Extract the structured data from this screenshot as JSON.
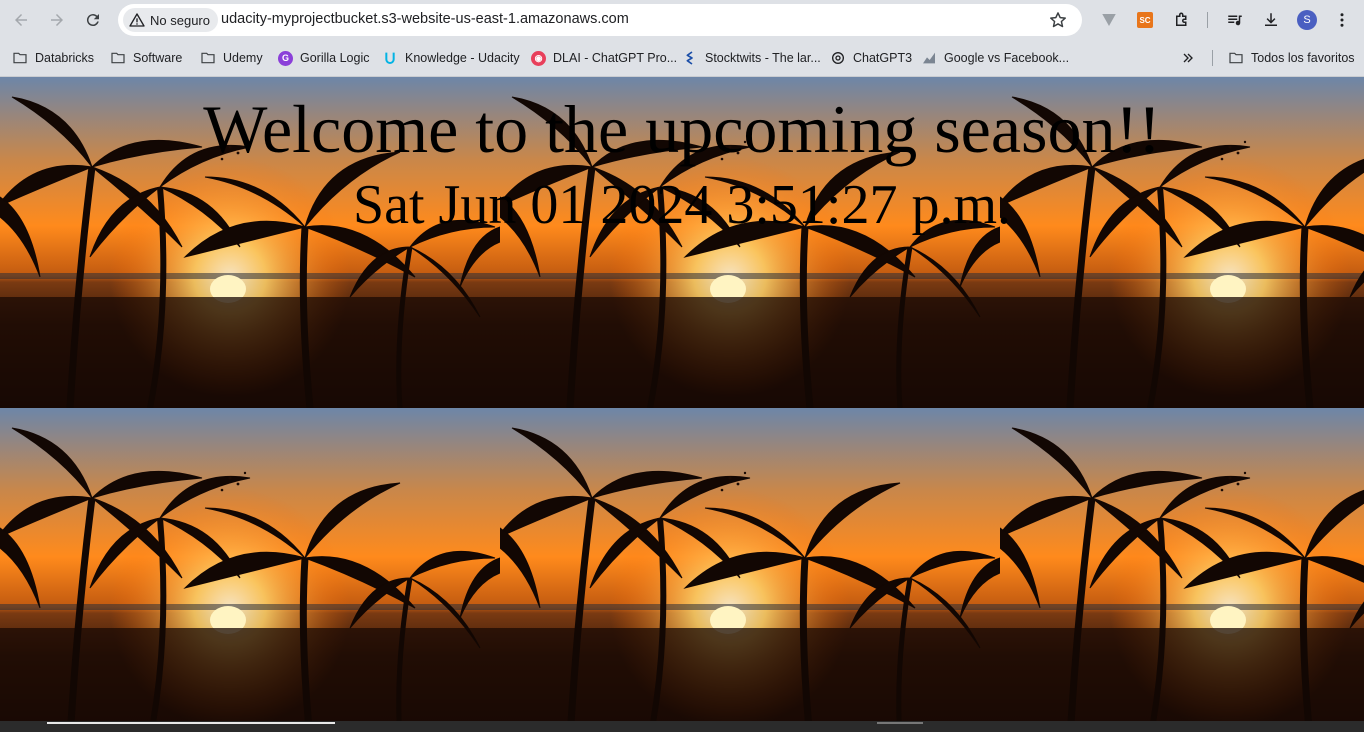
{
  "browser": {
    "security_label": "No seguro",
    "url": "udacity-myprojectbucket.s3-website-us-east-1.amazonaws.com",
    "extension_sc_label": "SC",
    "profile_initial": "S"
  },
  "bookmarks": {
    "items": [
      {
        "label": "Databricks",
        "icon": "folder-icon"
      },
      {
        "label": "Software",
        "icon": "folder-icon"
      },
      {
        "label": "Udemy",
        "icon": "folder-icon"
      },
      {
        "label": "Gorilla Logic",
        "icon": "gorilla-logic-icon",
        "color": "#8b3fd9"
      },
      {
        "label": "Knowledge - Udacity",
        "icon": "udacity-icon",
        "color": "#02b3e4"
      },
      {
        "label": "DLAI - ChatGPT Pro...",
        "icon": "dlai-icon",
        "color": "#e83f5b"
      },
      {
        "label": "Stocktwits - The lar...",
        "icon": "stocktwits-icon",
        "color": "#1b4ea8"
      },
      {
        "label": "ChatGPT3",
        "icon": "openai-icon",
        "color": "#202124"
      },
      {
        "label": "Google vs Facebook...",
        "icon": "chart-icon",
        "color": "#7b8592"
      }
    ],
    "all_bookmarks_label": "Todos los favoritos"
  },
  "page": {
    "title": "Welcome to the upcoming season!!",
    "datetime": "Sat Jun 01 2024 3:51:27 p.m.",
    "background_image": "sunset-palm-trees"
  },
  "colors": {
    "chrome_bg": "#dee1e6",
    "sky_top": "#6d86a8",
    "sun": "#fff4c2",
    "ember": "#ff6a00"
  }
}
